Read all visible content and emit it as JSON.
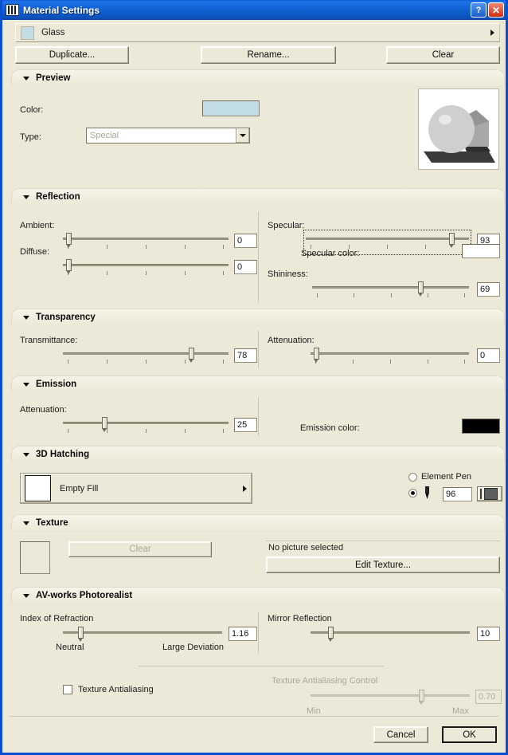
{
  "window": {
    "title": "Material Settings",
    "icon": "material-bars-icon",
    "help_button": "?",
    "close_button": "✕"
  },
  "material": {
    "name": "Glass",
    "swatch_color": "#c2dde5",
    "buttons": {
      "duplicate": "Duplicate...",
      "rename": "Rename...",
      "clear": "Clear"
    }
  },
  "sections": {
    "preview": {
      "title": "Preview",
      "color_label": "Color:",
      "color_value": "#c2dde5",
      "type_label": "Type:",
      "type_value": "Special"
    },
    "reflection": {
      "title": "Reflection",
      "ambient_label": "Ambient:",
      "ambient_value": "0",
      "diffuse_label": "Diffuse:",
      "diffuse_value": "0",
      "specular_label": "Specular:",
      "specular_value": "93",
      "specular_color_label": "Specular color:",
      "specular_color_value": "#ffffff",
      "shininess_label": "Shininess:",
      "shininess_value": "69"
    },
    "transparency": {
      "title": "Transparency",
      "transmittance_label": "Transmittance:",
      "transmittance_value": "78",
      "attenuation_label": "Attenuation:",
      "attenuation_value": "0"
    },
    "emission": {
      "title": "Emission",
      "attenuation_label": "Attenuation:",
      "attenuation_value": "25",
      "color_label": "Emission color:",
      "color_value": "#000000"
    },
    "hatching": {
      "title": "3D Hatching",
      "fill_name": "Empty Fill",
      "fill_color": "#ffffff",
      "element_pen_label": "Element Pen",
      "element_pen_selected": false,
      "custom_pen_selected": true,
      "pen_value": "96"
    },
    "texture": {
      "title": "Texture",
      "clear_label": "Clear",
      "status": "No picture selected",
      "edit_label": "Edit Texture..."
    },
    "photorealist": {
      "title": "AV-works Photorealist",
      "ior_label": "Index of Refraction",
      "ior_value": "1.16",
      "ior_min_label": "Neutral",
      "ior_max_label": "Large Deviation",
      "mirror_label": "Mirror Reflection",
      "mirror_value": "10",
      "antialias_label": "Texture Antialiasing",
      "antialias_checked": false,
      "aa_control_label": "Texture Antialiasing Control",
      "aa_control_value": "0.70",
      "aa_min_label": "Min",
      "aa_max_label": "Max"
    }
  },
  "footer": {
    "cancel": "Cancel",
    "ok": "OK"
  }
}
